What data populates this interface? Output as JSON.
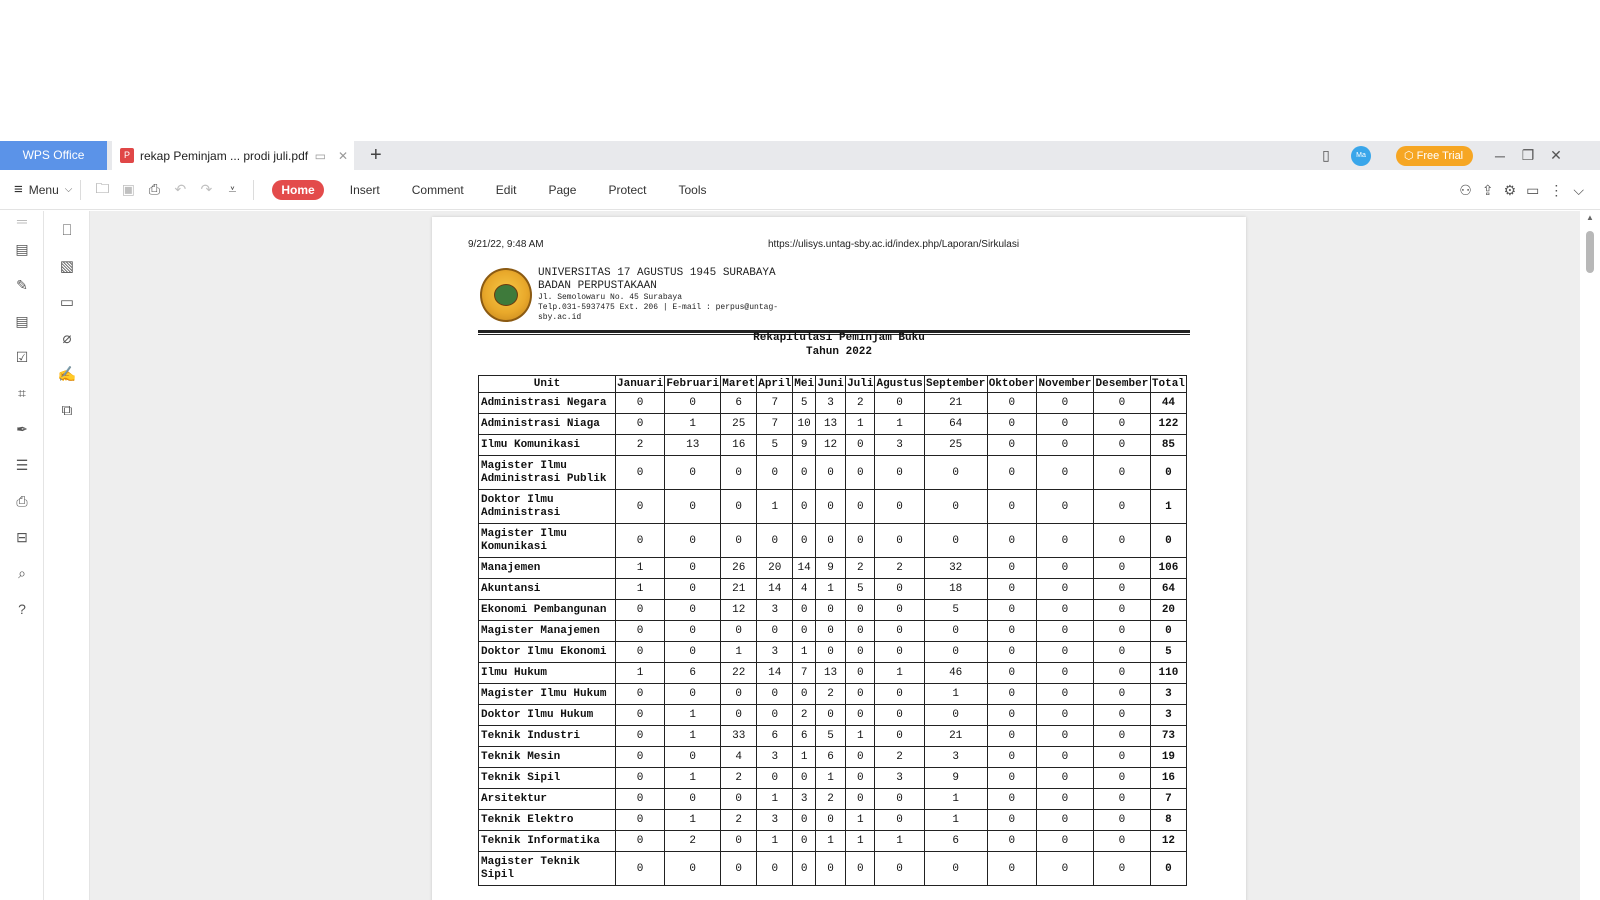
{
  "window": {
    "app_tab": "WPS Office",
    "doc_tab_title": "rekap Peminjam ... prodi juli.pdf",
    "new_tab": "+",
    "avatar": "Ma",
    "free_trial": "Free Trial",
    "min": "─",
    "restore": "❐",
    "close": "✕"
  },
  "toolbar": {
    "menu_label": "Menu",
    "tabs": [
      "Home",
      "Insert",
      "Comment",
      "Edit",
      "Page",
      "Protect",
      "Tools"
    ]
  },
  "pdf": {
    "print_date": "9/21/22, 9:48 AM",
    "print_url": "https://ulisys.untag-sby.ac.id/index.php/Laporan/Sirkulasi",
    "letterhead": {
      "line1": "UNIVERSITAS 17 AGUSTUS 1945 SURABAYA",
      "line2": "BADAN PERPUSTAKAAN",
      "line3": "Jl. Semolowaru No. 45 Surabaya",
      "line4": "Telp.031-5937475 Ext. 206 | E-mail : perpus@untag-",
      "line5": "sby.ac.id"
    },
    "report_title": "Rekapitulasi Peminjam Buku",
    "report_year": "Tahun 2022",
    "columns": [
      "Unit",
      "Januari",
      "Februari",
      "Maret",
      "April",
      "Mei",
      "Juni",
      "Juli",
      "Agustus",
      "September",
      "Oktober",
      "November",
      "Desember",
      "Total"
    ],
    "rows": [
      {
        "unit": "Administrasi Negara",
        "v": [
          "0",
          "0",
          "6",
          "7",
          "5",
          "3",
          "2",
          "0",
          "21",
          "0",
          "0",
          "0"
        ],
        "total": "44"
      },
      {
        "unit": "Administrasi Niaga",
        "v": [
          "0",
          "1",
          "25",
          "7",
          "10",
          "13",
          "1",
          "1",
          "64",
          "0",
          "0",
          "0"
        ],
        "total": "122"
      },
      {
        "unit": "Ilmu Komunikasi",
        "v": [
          "2",
          "13",
          "16",
          "5",
          "9",
          "12",
          "0",
          "3",
          "25",
          "0",
          "0",
          "0"
        ],
        "total": "85"
      },
      {
        "unit": "Magister Ilmu Administrasi Publik",
        "v": [
          "0",
          "0",
          "0",
          "0",
          "0",
          "0",
          "0",
          "0",
          "0",
          "0",
          "0",
          "0"
        ],
        "total": "0",
        "tall": true
      },
      {
        "unit": "Doktor Ilmu Administrasi",
        "v": [
          "0",
          "0",
          "0",
          "1",
          "0",
          "0",
          "0",
          "0",
          "0",
          "0",
          "0",
          "0"
        ],
        "total": "1",
        "tall": true
      },
      {
        "unit": "Magister Ilmu Komunikasi",
        "v": [
          "0",
          "0",
          "0",
          "0",
          "0",
          "0",
          "0",
          "0",
          "0",
          "0",
          "0",
          "0"
        ],
        "total": "0",
        "tall": true
      },
      {
        "unit": "Manajemen",
        "v": [
          "1",
          "0",
          "26",
          "20",
          "14",
          "9",
          "2",
          "2",
          "32",
          "0",
          "0",
          "0"
        ],
        "total": "106"
      },
      {
        "unit": "Akuntansi",
        "v": [
          "1",
          "0",
          "21",
          "14",
          "4",
          "1",
          "5",
          "0",
          "18",
          "0",
          "0",
          "0"
        ],
        "total": "64"
      },
      {
        "unit": "Ekonomi Pembangunan",
        "v": [
          "0",
          "0",
          "12",
          "3",
          "0",
          "0",
          "0",
          "0",
          "5",
          "0",
          "0",
          "0"
        ],
        "total": "20"
      },
      {
        "unit": "Magister Manajemen",
        "v": [
          "0",
          "0",
          "0",
          "0",
          "0",
          "0",
          "0",
          "0",
          "0",
          "0",
          "0",
          "0"
        ],
        "total": "0"
      },
      {
        "unit": "Doktor Ilmu Ekonomi",
        "v": [
          "0",
          "0",
          "1",
          "3",
          "1",
          "0",
          "0",
          "0",
          "0",
          "0",
          "0",
          "0"
        ],
        "total": "5"
      },
      {
        "unit": "Ilmu Hukum",
        "v": [
          "1",
          "6",
          "22",
          "14",
          "7",
          "13",
          "0",
          "1",
          "46",
          "0",
          "0",
          "0"
        ],
        "total": "110"
      },
      {
        "unit": "Magister Ilmu Hukum",
        "v": [
          "0",
          "0",
          "0",
          "0",
          "0",
          "2",
          "0",
          "0",
          "1",
          "0",
          "0",
          "0"
        ],
        "total": "3"
      },
      {
        "unit": "Doktor Ilmu Hukum",
        "v": [
          "0",
          "1",
          "0",
          "0",
          "2",
          "0",
          "0",
          "0",
          "0",
          "0",
          "0",
          "0"
        ],
        "total": "3"
      },
      {
        "unit": "Teknik Industri",
        "v": [
          "0",
          "1",
          "33",
          "6",
          "6",
          "5",
          "1",
          "0",
          "21",
          "0",
          "0",
          "0"
        ],
        "total": "73"
      },
      {
        "unit": "Teknik Mesin",
        "v": [
          "0",
          "0",
          "4",
          "3",
          "1",
          "6",
          "0",
          "2",
          "3",
          "0",
          "0",
          "0"
        ],
        "total": "19"
      },
      {
        "unit": "Teknik Sipil",
        "v": [
          "0",
          "1",
          "2",
          "0",
          "0",
          "1",
          "0",
          "3",
          "9",
          "0",
          "0",
          "0"
        ],
        "total": "16"
      },
      {
        "unit": "Arsitektur",
        "v": [
          "0",
          "0",
          "0",
          "1",
          "3",
          "2",
          "0",
          "0",
          "1",
          "0",
          "0",
          "0"
        ],
        "total": "7"
      },
      {
        "unit": "Teknik Elektro",
        "v": [
          "0",
          "1",
          "2",
          "3",
          "0",
          "0",
          "1",
          "0",
          "1",
          "0",
          "0",
          "0"
        ],
        "total": "8"
      },
      {
        "unit": "Teknik Informatika",
        "v": [
          "0",
          "2",
          "0",
          "1",
          "0",
          "1",
          "1",
          "1",
          "6",
          "0",
          "0",
          "0"
        ],
        "total": "12"
      },
      {
        "unit": "Magister Teknik Sipil",
        "v": [
          "0",
          "0",
          "0",
          "0",
          "0",
          "0",
          "0",
          "0",
          "0",
          "0",
          "0",
          "0"
        ],
        "total": "0",
        "tall": true
      }
    ]
  }
}
